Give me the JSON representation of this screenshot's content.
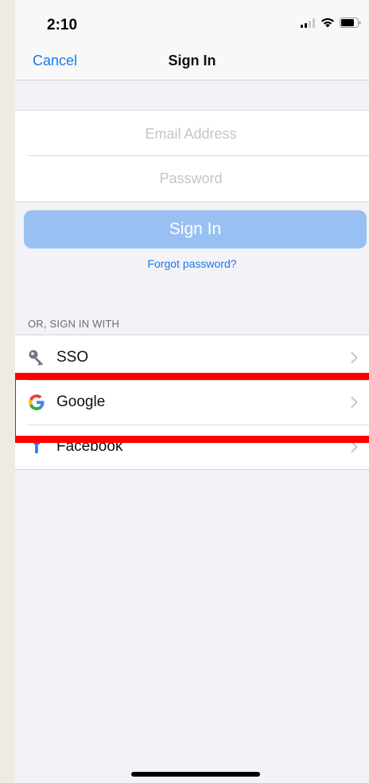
{
  "status_bar": {
    "time": "2:10",
    "icons": [
      "cellular-signal-icon",
      "wifi-icon",
      "battery-icon"
    ]
  },
  "nav": {
    "cancel_label": "Cancel",
    "title": "Sign In"
  },
  "form": {
    "email_placeholder": "Email Address",
    "email_value": "",
    "password_placeholder": "Password",
    "password_value": ""
  },
  "signin_button_label": "Sign In",
  "forgot_password_label": "Forgot password?",
  "alt_signin": {
    "header": "OR, SIGN IN WITH",
    "providers": [
      {
        "label": "SSO",
        "icon": "key-icon"
      },
      {
        "label": "Google",
        "icon": "google-icon"
      },
      {
        "label": "Facebook",
        "icon": "facebook-icon"
      }
    ]
  },
  "colors": {
    "accent": "#1a7ae6",
    "signin_button_disabled": "#99c0f3",
    "highlight": "#ff0000",
    "facebook": "#1877f2"
  }
}
